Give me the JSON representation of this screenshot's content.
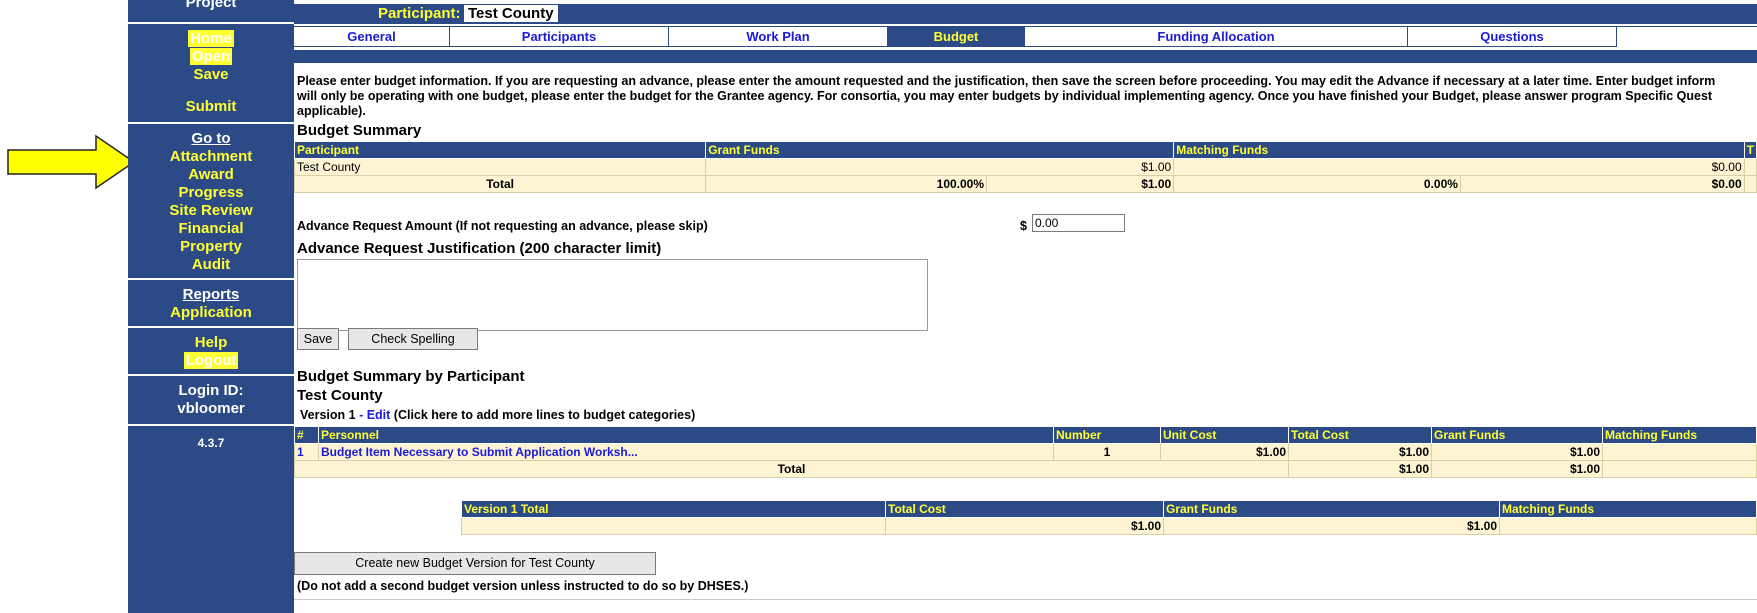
{
  "sidebar": {
    "project": "Project",
    "home": "Home",
    "open": "Open",
    "save": "Save",
    "submit": "Submit",
    "goto": "Go to",
    "attachment": "Attachment",
    "award": "Award",
    "progress": "Progress",
    "site_review": "Site Review",
    "financial": "Financial",
    "property": "Property",
    "audit": "Audit",
    "reports": "Reports",
    "application": "Application",
    "help": "Help",
    "logout": "Logout",
    "login_label": "Login ID:",
    "login_value": "vbloomer",
    "version": "4.3.7"
  },
  "header": {
    "participant_label": "Participant:",
    "participant_value": "Test County"
  },
  "tabs": [
    "General",
    "Participants",
    "Work Plan",
    "Budget",
    "Funding Allocation",
    "Questions"
  ],
  "intro": {
    "line1": "Please enter budget information. If you are requesting an advance, please enter the amount requested and the justification, then save the screen before proceeding. You may edit the Advance if necessary at a later time. Enter budget inform",
    "line2": "will only be operating with one budget, please enter the budget for the Grantee agency. For consortia, you may enter budgets by individual implementing agency. Once you have finished your Budget, please answer program Specific Quest",
    "line3": "applicable)."
  },
  "budget_summary": {
    "title": "Budget Summary",
    "headers": [
      "Participant",
      "Grant Funds",
      "Matching Funds",
      "T"
    ],
    "row": {
      "participant": "Test County",
      "grant": "$1.00",
      "matching": "$0.00"
    },
    "total": {
      "label": "Total",
      "grant_pct": "100.00%",
      "grant": "$1.00",
      "matching_pct": "0.00%",
      "matching": "$0.00"
    }
  },
  "advance": {
    "label": "Advance Request Amount (If not requesting an advance, please skip)",
    "dollar": "$",
    "value": "0.00",
    "justification_title": "Advance Request Justification (200 character limit)",
    "save_button": "Save",
    "spell_button": "Check Spelling"
  },
  "by_participant": {
    "title": "Budget Summary by Participant",
    "participant": "Test County",
    "version_text": "Version 1",
    "version_sep": " - ",
    "edit_link": "Edit",
    "version_hint": " (Click here to add more lines to budget categories)",
    "headers": [
      "#",
      "Personnel",
      "Number",
      "Unit Cost",
      "Total Cost",
      "Grant Funds",
      "Matching Funds"
    ],
    "row": {
      "num": "1",
      "item": "Budget Item Necessary to Submit Application Worksh...",
      "number": "1",
      "unit": "$1.00",
      "total": "$1.00",
      "grant": "$1.00"
    },
    "total": {
      "label": "Total",
      "total": "$1.00",
      "grant": "$1.00"
    }
  },
  "version_total": {
    "headers": [
      "Version 1 Total",
      "Total Cost",
      "Grant Funds",
      "Matching Funds"
    ],
    "total_cost": "$1.00",
    "grant": "$1.00"
  },
  "create_button": "Create new Budget Version for Test County",
  "warning": "(Do not add a second budget version unless instructed to do so by DHSES.)"
}
